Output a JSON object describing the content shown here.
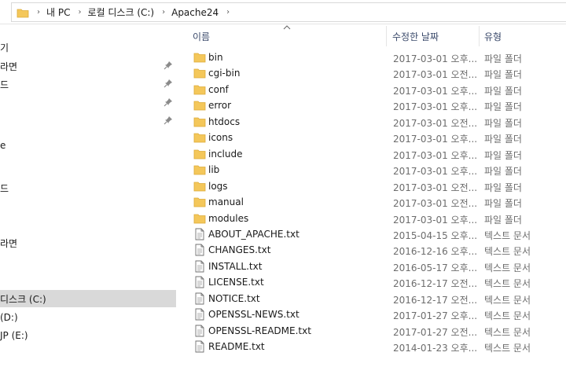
{
  "address": {
    "crumbs": [
      "내 PC",
      "로컬 디스크 (C:)",
      "Apache24"
    ]
  },
  "nav": {
    "items": [
      {
        "label": "기",
        "pinned": false,
        "selected": false
      },
      {
        "label": "라면",
        "pinned": true,
        "selected": false
      },
      {
        "label": "드",
        "pinned": true,
        "selected": false
      },
      {
        "label": "",
        "pinned": true,
        "selected": false
      },
      {
        "label": "",
        "pinned": true,
        "selected": false
      },
      {
        "label": "e",
        "pinned": false,
        "selected": false
      },
      {
        "label": "드",
        "pinned": false,
        "selected": false
      },
      {
        "label": "라면",
        "pinned": false,
        "selected": false
      },
      {
        "label": "디스크 (C:)",
        "pinned": false,
        "selected": true
      },
      {
        "label": "(D:)",
        "pinned": false,
        "selected": false
      },
      {
        "label": "JP (E:)",
        "pinned": false,
        "selected": false
      }
    ]
  },
  "columns": {
    "name": "이름",
    "date": "수정한 날짜",
    "type": "유형"
  },
  "files": [
    {
      "name": "bin",
      "date": "2017-03-01 오후...",
      "type": "파일 폴더",
      "kind": "folder"
    },
    {
      "name": "cgi-bin",
      "date": "2017-03-01 오전...",
      "type": "파일 폴더",
      "kind": "folder"
    },
    {
      "name": "conf",
      "date": "2017-03-01 오후...",
      "type": "파일 폴더",
      "kind": "folder"
    },
    {
      "name": "error",
      "date": "2017-03-01 오후...",
      "type": "파일 폴더",
      "kind": "folder"
    },
    {
      "name": "htdocs",
      "date": "2017-03-01 오전...",
      "type": "파일 폴더",
      "kind": "folder"
    },
    {
      "name": "icons",
      "date": "2017-03-01 오후...",
      "type": "파일 폴더",
      "kind": "folder"
    },
    {
      "name": "include",
      "date": "2017-03-01 오후...",
      "type": "파일 폴더",
      "kind": "folder"
    },
    {
      "name": "lib",
      "date": "2017-03-01 오후...",
      "type": "파일 폴더",
      "kind": "folder"
    },
    {
      "name": "logs",
      "date": "2017-03-01 오전...",
      "type": "파일 폴더",
      "kind": "folder"
    },
    {
      "name": "manual",
      "date": "2017-03-01 오전...",
      "type": "파일 폴더",
      "kind": "folder"
    },
    {
      "name": "modules",
      "date": "2017-03-01 오후...",
      "type": "파일 폴더",
      "kind": "folder"
    },
    {
      "name": "ABOUT_APACHE.txt",
      "date": "2015-04-15 오후...",
      "type": "텍스트 문서",
      "kind": "text"
    },
    {
      "name": "CHANGES.txt",
      "date": "2016-12-16 오후...",
      "type": "텍스트 문서",
      "kind": "text"
    },
    {
      "name": "INSTALL.txt",
      "date": "2016-05-17 오후...",
      "type": "텍스트 문서",
      "kind": "text"
    },
    {
      "name": "LICENSE.txt",
      "date": "2016-12-17 오전...",
      "type": "텍스트 문서",
      "kind": "text"
    },
    {
      "name": "NOTICE.txt",
      "date": "2016-12-17 오전...",
      "type": "텍스트 문서",
      "kind": "text"
    },
    {
      "name": "OPENSSL-NEWS.txt",
      "date": "2017-01-27 오후...",
      "type": "텍스트 문서",
      "kind": "text"
    },
    {
      "name": "OPENSSL-README.txt",
      "date": "2017-01-27 오전...",
      "type": "텍스트 문서",
      "kind": "text"
    },
    {
      "name": "README.txt",
      "date": "2014-01-23 오후...",
      "type": "텍스트 문서",
      "kind": "text"
    }
  ],
  "colors": {
    "folder": "#f4c75a",
    "folder_dark": "#dcaa38",
    "selected_bg": "#d9d9d9",
    "header_text": "#3b4a6b"
  },
  "icons": {
    "folder": "folder-icon",
    "text": "text-file-icon",
    "pin": "pin-icon",
    "sort": "sort-up-icon"
  }
}
